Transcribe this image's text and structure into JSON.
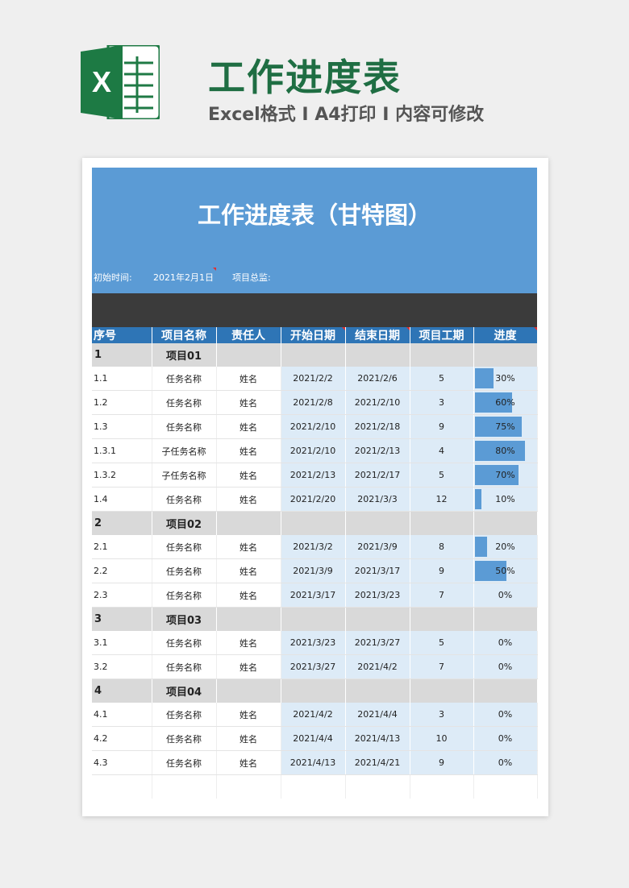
{
  "header": {
    "title": "工作进度表",
    "subtitle": "Excel格式 I A4打印 I 内容可修改",
    "logo_letter": "X"
  },
  "sheet": {
    "title": "工作进度表（甘特图）",
    "start_label": "初始时间:",
    "start_value": "2021年2月1日",
    "total_label": "项目总监:"
  },
  "columns": [
    "序号",
    "项目名称",
    "责任人",
    "开始日期",
    "结束日期",
    "项目工期",
    "进度"
  ],
  "rows": [
    {
      "type": "group",
      "no": "1",
      "name": "项目01"
    },
    {
      "type": "task",
      "no": "1.1",
      "name": "任务名称",
      "owner": "姓名",
      "start": "2021/2/2",
      "end": "2021/2/6",
      "duration": "5",
      "progress_label": "30%",
      "progress": 0.3
    },
    {
      "type": "task",
      "no": "1.2",
      "name": "任务名称",
      "owner": "姓名",
      "start": "2021/2/8",
      "end": "2021/2/10",
      "duration": "3",
      "progress_label": "60%",
      "progress": 0.6
    },
    {
      "type": "task",
      "no": "1.3",
      "name": "任务名称",
      "owner": "姓名",
      "start": "2021/2/10",
      "end": "2021/2/18",
      "duration": "9",
      "progress_label": "75%",
      "progress": 0.75
    },
    {
      "type": "task",
      "no": "1.3.1",
      "name": "子任务名称",
      "owner": "姓名",
      "start": "2021/2/10",
      "end": "2021/2/13",
      "duration": "4",
      "progress_label": "80%",
      "progress": 0.8
    },
    {
      "type": "task",
      "no": "1.3.2",
      "name": "子任务名称",
      "owner": "姓名",
      "start": "2021/2/13",
      "end": "2021/2/17",
      "duration": "5",
      "progress_label": "70%",
      "progress": 0.7
    },
    {
      "type": "task",
      "no": "1.4",
      "name": "任务名称",
      "owner": "姓名",
      "start": "2021/2/20",
      "end": "2021/3/3",
      "duration": "12",
      "progress_label": "10%",
      "progress": 0.1
    },
    {
      "type": "group",
      "no": "2",
      "name": "项目02"
    },
    {
      "type": "task",
      "no": "2.1",
      "name": "任务名称",
      "owner": "姓名",
      "start": "2021/3/2",
      "end": "2021/3/9",
      "duration": "8",
      "progress_label": "20%",
      "progress": 0.2
    },
    {
      "type": "task",
      "no": "2.2",
      "name": "任务名称",
      "owner": "姓名",
      "start": "2021/3/9",
      "end": "2021/3/17",
      "duration": "9",
      "progress_label": "50%",
      "progress": 0.5
    },
    {
      "type": "task",
      "no": "2.3",
      "name": "任务名称",
      "owner": "姓名",
      "start": "2021/3/17",
      "end": "2021/3/23",
      "duration": "7",
      "progress_label": "0%",
      "progress": 0
    },
    {
      "type": "group",
      "no": "3",
      "name": "项目03"
    },
    {
      "type": "task",
      "no": "3.1",
      "name": "任务名称",
      "owner": "姓名",
      "start": "2021/3/23",
      "end": "2021/3/27",
      "duration": "5",
      "progress_label": "0%",
      "progress": 0
    },
    {
      "type": "task",
      "no": "3.2",
      "name": "任务名称",
      "owner": "姓名",
      "start": "2021/3/27",
      "end": "2021/4/2",
      "duration": "7",
      "progress_label": "0%",
      "progress": 0
    },
    {
      "type": "group",
      "no": "4",
      "name": "项目04"
    },
    {
      "type": "task",
      "no": "4.1",
      "name": "任务名称",
      "owner": "姓名",
      "start": "2021/4/2",
      "end": "2021/4/4",
      "duration": "3",
      "progress_label": "0%",
      "progress": 0
    },
    {
      "type": "task",
      "no": "4.2",
      "name": "任务名称",
      "owner": "姓名",
      "start": "2021/4/4",
      "end": "2021/4/13",
      "duration": "10",
      "progress_label": "0%",
      "progress": 0
    },
    {
      "type": "task",
      "no": "4.3",
      "name": "任务名称",
      "owner": "姓名",
      "start": "2021/4/13",
      "end": "2021/4/21",
      "duration": "9",
      "progress_label": "0%",
      "progress": 0
    },
    {
      "type": "empty"
    }
  ],
  "colors": {
    "brand_green": "#1f6e43",
    "header_blue": "#2e75b6",
    "banner_blue": "#5b9bd5",
    "light_blue": "#ddebf7",
    "group_gray": "#d9d9d9"
  }
}
